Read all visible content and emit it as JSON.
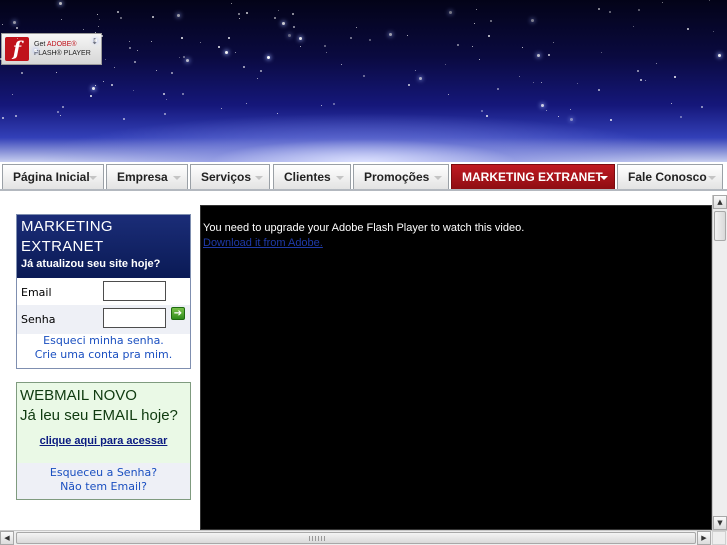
{
  "flash_badge": {
    "line1_prefix": "Get ",
    "line1_brand": "ADOBE®",
    "line2": "FLASH® PLAYER",
    "logo_letter": "f"
  },
  "nav": {
    "tabs": [
      {
        "label": "Página Inicial"
      },
      {
        "label": "Empresa"
      },
      {
        "label": "Serviços"
      },
      {
        "label": "Clientes"
      },
      {
        "label": "Promoções"
      },
      {
        "label": "MARKETING EXTRANET",
        "active": true
      },
      {
        "label": "Fale Conosco"
      }
    ]
  },
  "marketing_box": {
    "title": "MARKETING EXTRANET",
    "subtitle": "Já atualizou seu site hoje?",
    "email_label": "Email",
    "email_value": "",
    "password_label": "Senha",
    "password_value": "",
    "forgot_link": "Esqueci minha senha.",
    "create_link": "Crie uma conta pra mim."
  },
  "webmail_box": {
    "title": "WEBMAIL NOVO",
    "subtitle": "Já leu seu EMAIL hoje?",
    "access_link": "clique aqui para acessar",
    "forgot_link": "Esqueceu a Senha?",
    "no_email_link": "Não tem Email?"
  },
  "video_panel": {
    "message": "You need to upgrade your Adobe Flash Player to watch this video.",
    "download_link": "Download it from Adobe."
  },
  "colors": {
    "active_tab": "#b0161d",
    "marketing_header": "#0f1f62",
    "webmail_bg": "#eaf9e6",
    "link": "#1a4fc0"
  }
}
